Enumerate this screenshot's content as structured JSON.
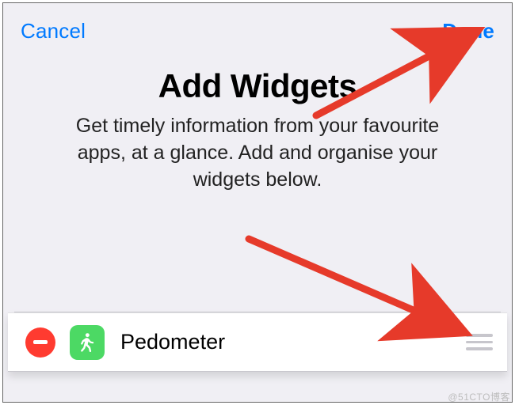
{
  "navbar": {
    "cancel_label": "Cancel",
    "done_label": "Done"
  },
  "hero": {
    "title": "Add Widgets",
    "subtitle": "Get timely information from your favourite apps, at a glance. Add and organise your widgets below."
  },
  "widgets": [
    {
      "name": "Pedometer",
      "icon_name": "walking-person-icon",
      "icon_bg": "#4cd964"
    }
  ],
  "annotations": {
    "arrow_color": "#e63a2a"
  },
  "watermark": "@51CTO博客"
}
